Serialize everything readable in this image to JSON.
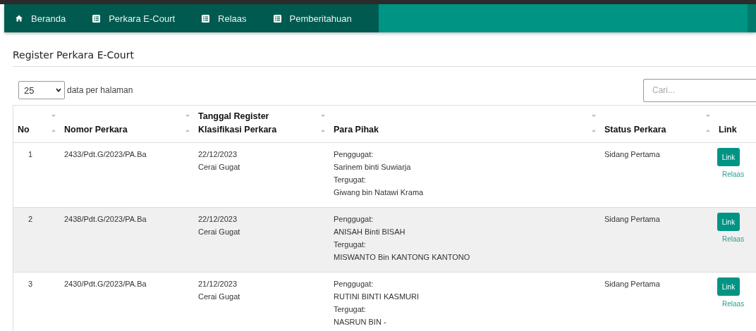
{
  "navbar": {
    "items": [
      {
        "kind": "home",
        "label": "Beranda"
      },
      {
        "kind": "list",
        "label": "Perkara E-Court"
      },
      {
        "kind": "list",
        "label": "Relaas"
      },
      {
        "kind": "list",
        "label": "Pemberitahuan"
      }
    ]
  },
  "page_title": "Register Perkara E-Court",
  "length_select": {
    "value": "25",
    "label": "data per halaman"
  },
  "search": {
    "placeholder": "Cari..."
  },
  "table": {
    "columns": [
      [
        "No"
      ],
      [
        "Nomor Perkara"
      ],
      [
        "Tanggal Register",
        "Klasifikasi Perkara"
      ],
      [
        "Para Pihak"
      ],
      [
        "Status Perkara"
      ],
      [
        "Link"
      ]
    ],
    "rows": [
      {
        "no": "1",
        "nomor": "2433/Pdt.G/2023/PA.Ba",
        "tanggal": "22/12/2023",
        "klasifikasi": "Cerai Gugat",
        "parties": [
          "Penggugat:",
          "Sarinem binti Suwiarja",
          "Tergugat:",
          "Giwang bin Natawi Krama"
        ],
        "status": "Sidang Pertama",
        "button": "Link",
        "link": "Relaas"
      },
      {
        "no": "2",
        "nomor": "2438/Pdt.G/2023/PA.Ba",
        "tanggal": "22/12/2023",
        "klasifikasi": "Cerai Gugat",
        "parties": [
          "Penggugat:",
          "ANISAH Binti BISAH",
          "Tergugat:",
          "MISWANTO Bin KANTONG KANTONO"
        ],
        "status": "Sidang Pertama",
        "button": "Link",
        "link": "Relaas"
      },
      {
        "no": "3",
        "nomor": "2430/Pdt.G/2023/PA.Ba",
        "tanggal": "21/12/2023",
        "klasifikasi": "Cerai Gugat",
        "parties": [
          "Penggugat:",
          "RUTINI BINTI KASMURI",
          "Tergugat:",
          "NASRUN BIN -"
        ],
        "status": "Sidang Pertama",
        "button": "Link",
        "link": "Relaas"
      }
    ]
  }
}
